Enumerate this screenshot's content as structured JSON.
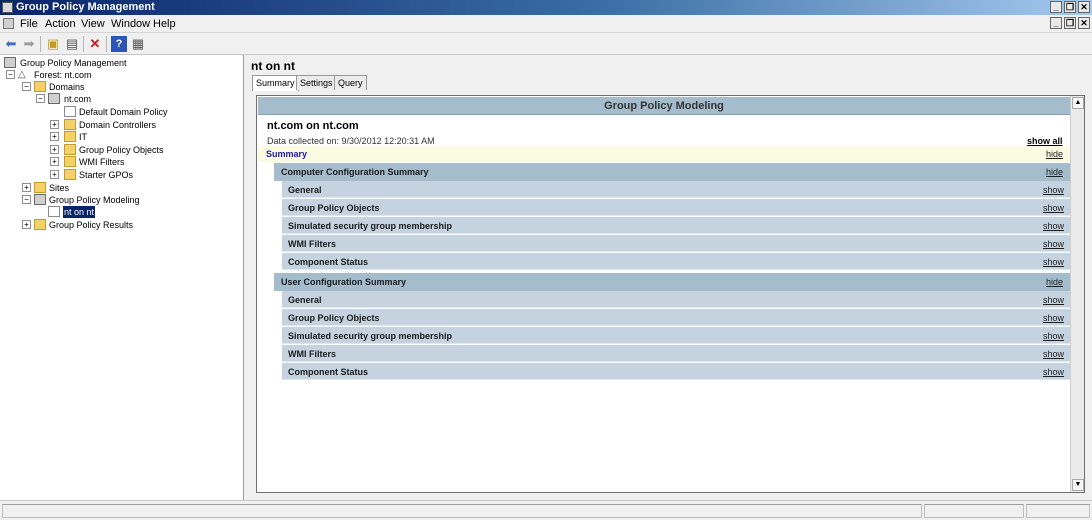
{
  "window": {
    "title": "Group Policy Management",
    "app_icon": "gpmc-icon",
    "controls": [
      "_",
      "❐",
      "✕"
    ]
  },
  "menu": {
    "items": [
      "File",
      "Action",
      "View",
      "Window",
      "Help"
    ]
  },
  "toolbar": {
    "icons": [
      "back-arrow-icon",
      "forward-arrow-icon",
      "up-folder-icon",
      "show-hide-tree-icon",
      "delete-icon",
      "help-icon",
      "properties-icon"
    ]
  },
  "tree": {
    "root": "Group Policy Management",
    "forest": "Forest: nt.com",
    "domains": "Domains",
    "domain": "nt.com",
    "default_domain_policy": "Default Domain Policy",
    "domain_controllers": "Domain Controllers",
    "it": "IT",
    "group_policy_objects": "Group Policy Objects",
    "wmi_filters": "WMI Filters",
    "starter_gpos": "Starter GPOs",
    "sites": "Sites",
    "gp_modeling": "Group Policy Modeling",
    "gp_modeling_item": "nt on nt",
    "gp_results": "Group Policy Results",
    "expand_glyph": "+",
    "collapse_glyph": "−"
  },
  "main": {
    "title": "nt on nt",
    "tabs": [
      "Summary",
      "Settings",
      "Query"
    ],
    "active_tab": "Summary"
  },
  "report": {
    "header": "Group Policy Modeling",
    "title": "nt.com on nt.com",
    "date": "Data collected on: 9/30/2012 12:20:31 AM",
    "show_all": "show all",
    "summary_label": "Summary",
    "hide": "hide",
    "show": "show",
    "computer_section": {
      "title": "Computer Configuration Summary",
      "items": [
        "General",
        "Group Policy Objects",
        "Simulated security group membership",
        "WMI Filters",
        "Component Status"
      ]
    },
    "user_section": {
      "title": "User Configuration Summary",
      "items": [
        "General",
        "Group Policy Objects",
        "Simulated security group membership",
        "WMI Filters",
        "Component Status"
      ]
    }
  },
  "colors": {
    "section_header": "#a5bccd",
    "item_row": "#c4d3df",
    "summary_bg": "#fbfbe3",
    "selection": "#0a246a"
  }
}
